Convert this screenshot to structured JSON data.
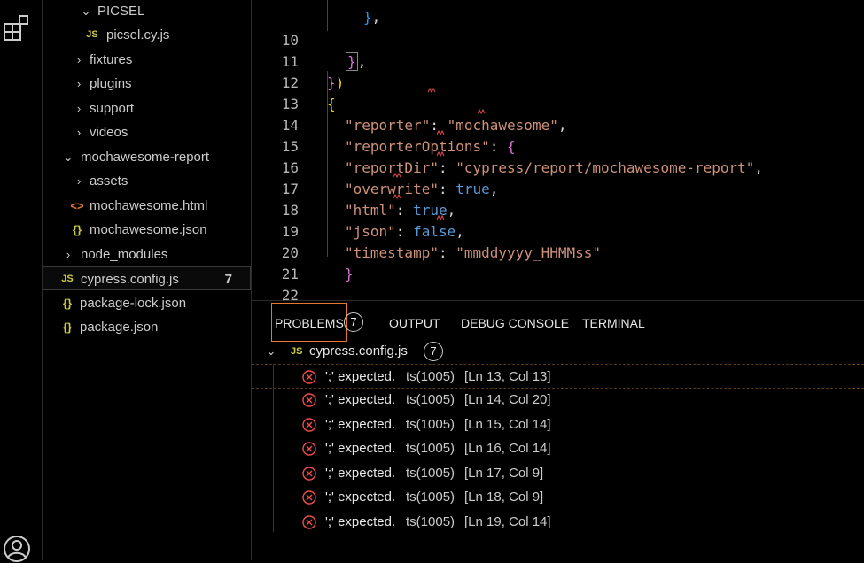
{
  "sidebar": {
    "rows": [
      {
        "label": "PICSEL",
        "chevron": "down",
        "icon": ""
      },
      {
        "label": "picsel.cy.js",
        "chevron": "",
        "icon": "JS"
      },
      {
        "label": "fixtures",
        "chevron": "right",
        "icon": ""
      },
      {
        "label": "plugins",
        "chevron": "right",
        "icon": ""
      },
      {
        "label": "support",
        "chevron": "right",
        "icon": ""
      },
      {
        "label": "videos",
        "chevron": "right",
        "icon": ""
      },
      {
        "label": "mochawesome-report",
        "chevron": "down",
        "icon": ""
      },
      {
        "label": "assets",
        "chevron": "right",
        "icon": ""
      },
      {
        "label": "mochawesome.html",
        "chevron": "",
        "icon": "<>"
      },
      {
        "label": "mochawesome.json",
        "chevron": "",
        "icon": "{}"
      },
      {
        "label": "node_modules",
        "chevron": "right",
        "icon": ""
      },
      {
        "label": "cypress.config.js",
        "chevron": "",
        "icon": "JS",
        "badge": "7"
      },
      {
        "label": "package-lock.json",
        "chevron": "",
        "icon": "{}"
      },
      {
        "label": "package.json",
        "chevron": "",
        "icon": "{}"
      }
    ]
  },
  "editor": {
    "line_numbers": [
      "10",
      "11",
      "12",
      "13",
      "14",
      "15",
      "16",
      "17",
      "18",
      "19",
      "20",
      "21",
      "22"
    ],
    "code": {
      "l10_close": "}",
      "l10_comma": ",",
      "l11_brace": "}",
      "l11_paren": ")",
      "l12_brace": "{",
      "l13_key": "\"reporter\"",
      "l13_colon": ":",
      "l13_val": "\"mochawesome\"",
      "l13_comma": ",",
      "l14_key": "\"reporterOptions\"",
      "l14_colon": ":",
      "l14_brace": "{",
      "l15_key": "\"reportDir\"",
      "l15_colon": ":",
      "l15_val": "\"cypress/report/mochawesome-report\"",
      "l15_comma": ",",
      "l16_key": "\"overwrite\"",
      "l16_colon": ":",
      "l16_val": "true",
      "l16_comma": ",",
      "l17_key": "\"html\"",
      "l17_colon": ":",
      "l17_val": "true",
      "l17_comma": ",",
      "l18_key": "\"json\"",
      "l18_colon": ":",
      "l18_val": "false",
      "l18_comma": ",",
      "l19_key": "\"timestamp\"",
      "l19_colon": ":",
      "l19_val": "\"mmddyyyy_HHMMss\"",
      "l20_brace": "}",
      "l22_brace": "}"
    }
  },
  "panel": {
    "tabs": {
      "problems": "PROBLEMS",
      "problems_count": "7",
      "output": "OUTPUT",
      "debug": "DEBUG CONSOLE",
      "terminal": "TERMINAL"
    },
    "file": {
      "icon": "JS",
      "name": "cypress.config.js",
      "count": "7"
    },
    "problems": [
      {
        "message": "';' expected.",
        "source": "ts(1005)",
        "location": "[Ln 13, Col 13]"
      },
      {
        "message": "';' expected.",
        "source": "ts(1005)",
        "location": "[Ln 14, Col 20]"
      },
      {
        "message": "';' expected.",
        "source": "ts(1005)",
        "location": "[Ln 15, Col 14]"
      },
      {
        "message": "';' expected.",
        "source": "ts(1005)",
        "location": "[Ln 16, Col 14]"
      },
      {
        "message": "';' expected.",
        "source": "ts(1005)",
        "location": "[Ln 17, Col 9]"
      },
      {
        "message": "';' expected.",
        "source": "ts(1005)",
        "location": "[Ln 18, Col 9]"
      },
      {
        "message": "';' expected.",
        "source": "ts(1005)",
        "location": "[Ln 19, Col 14]"
      }
    ]
  },
  "colors": {
    "error": "#f14c4c",
    "accent_orange": "#e37933",
    "js_yellow": "#cbcb41",
    "string": "#ce9178",
    "keyword": "#569cd6"
  },
  "icons": [
    "extensions-icon",
    "account-icon",
    "chevron-down-icon",
    "chevron-right-icon",
    "js-file-icon",
    "json-file-icon",
    "html-file-icon",
    "error-icon"
  ]
}
